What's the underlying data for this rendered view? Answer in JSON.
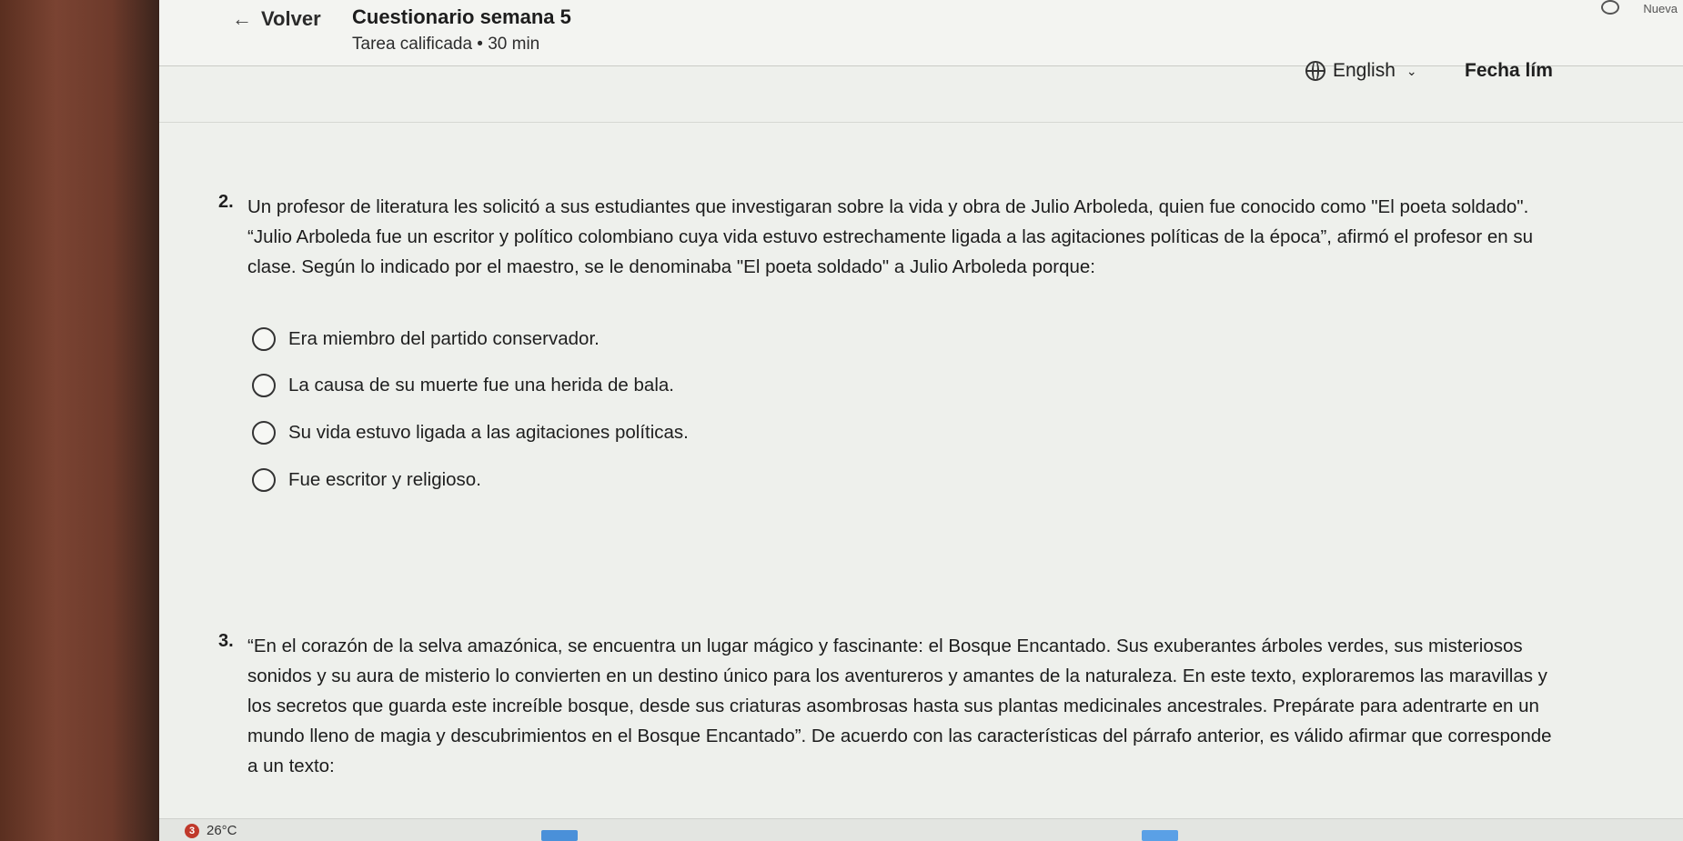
{
  "header": {
    "back_label": "Volver",
    "title": "Cuestionario semana 5",
    "subtitle": "Tarea calificada • 30 min",
    "language": "English",
    "due_label": "Fecha lím",
    "top_right_tab": "Nueva"
  },
  "questions": [
    {
      "number": "2.",
      "text": "Un profesor de literatura les solicitó a sus estudiantes que investigaran sobre la vida y obra de Julio Arboleda, quien fue conocido como \"El poeta soldado\". “Julio Arboleda fue un escritor y político colombiano cuya vida estuvo estrechamente ligada a las agitaciones políticas de la época”, afirmó el profesor en su clase. Según lo indicado por el maestro, se le denominaba \"El poeta soldado\" a Julio Arboleda porque:",
      "options": [
        "Era miembro del partido conservador.",
        "La causa de su muerte fue una herida de bala.",
        "Su vida estuvo ligada a las agitaciones políticas.",
        "Fue escritor y religioso."
      ]
    },
    {
      "number": "3.",
      "text": "“En el corazón de la selva amazónica, se encuentra un lugar mágico y fascinante: el Bosque Encantado. Sus exuberantes árboles verdes, sus misteriosos sonidos y su aura de misterio lo convierten en un destino único para los aventureros y amantes de la naturaleza. En este texto, exploraremos las maravillas y los secretos que guarda este increíble bosque, desde sus criaturas asombrosas hasta sus plantas medicinales ancestrales. Prepárate para adentrarte en un mundo lleno de magia y descubrimientos en el Bosque Encantado”. De acuerdo con las características del párrafo anterior, es válido afirmar que corresponde a un texto:"
    }
  ],
  "taskbar": {
    "weather_badge": "3",
    "temperature": "26°C"
  },
  "colors": {
    "page_background": "#eef0ec",
    "text": "#1f1f1f",
    "radio_border": "#333333"
  }
}
